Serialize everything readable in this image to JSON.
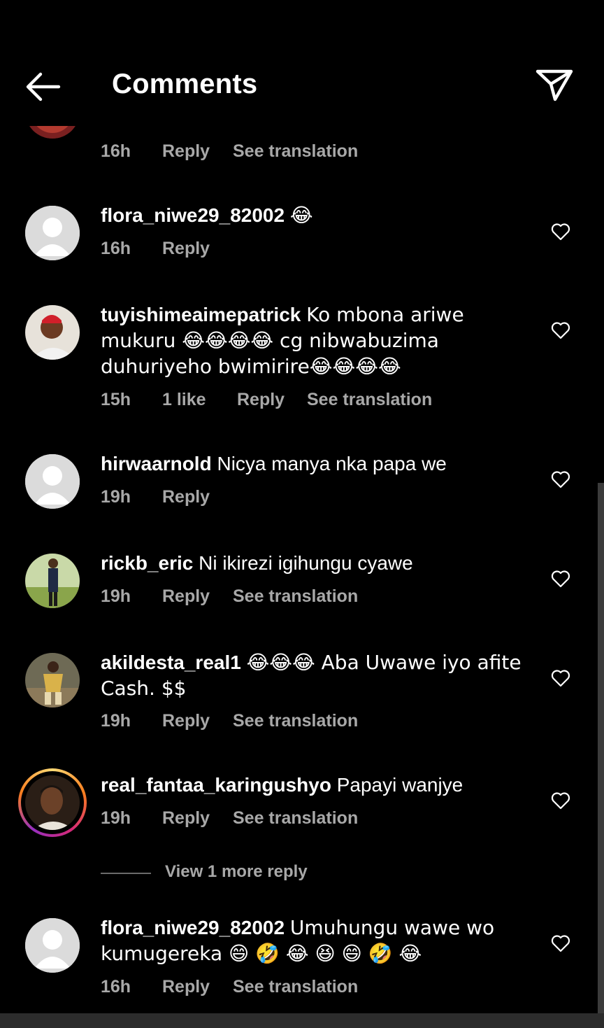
{
  "header": {
    "title": "Comments",
    "back_icon": "arrow-left-icon",
    "share_icon": "paper-plane-icon"
  },
  "partial_comment": {
    "time": "16h",
    "reply": "Reply",
    "translate": "See translation"
  },
  "comments": [
    {
      "username": "flora_niwe29_82002",
      "text": "😂",
      "time": "16h",
      "likes": "",
      "reply": "Reply",
      "translate": ""
    },
    {
      "username": "tuyishimeaimepatrick",
      "text": "Ko mbona ariwe mukuru 😂😂😂😂 cg nibwabuzima duhuriyeho bwimirire😂😂😂😂",
      "time": "15h",
      "likes": "1 like",
      "reply": "Reply",
      "translate": "See translation"
    },
    {
      "username": "hirwaarnold",
      "text": "Nicya manya nka papa we",
      "time": "19h",
      "likes": "",
      "reply": "Reply",
      "translate": ""
    },
    {
      "username": "rickb_eric",
      "text": "Ni ikirezi igihungu cyawe",
      "time": "19h",
      "likes": "",
      "reply": "Reply",
      "translate": "See translation"
    },
    {
      "username": "akildesta_real1",
      "text": "😂😂😂 Aba Uwawe iyo afite Cash. $$",
      "time": "19h",
      "likes": "",
      "reply": "Reply",
      "translate": "See translation"
    },
    {
      "username": "real_fantaa_karingushyo",
      "text": "Papayi wanjye",
      "time": "19h",
      "likes": "",
      "reply": "Reply",
      "translate": "See translation"
    },
    {
      "username": "flora_niwe29_82002",
      "text": "Umuhungu wawe wo kumugereka 😄 🤣 😂 😆 😄 🤣 😂",
      "time": "16h",
      "likes": "",
      "reply": "Reply",
      "translate": "See translation"
    }
  ],
  "view_more": "View 1 more reply",
  "colors": {
    "background": "#000000",
    "text": "#ffffff",
    "secondary": "#a8a8a8",
    "story_ring": [
      "#feda75",
      "#fa7e1e",
      "#d62976",
      "#962fbf"
    ]
  }
}
